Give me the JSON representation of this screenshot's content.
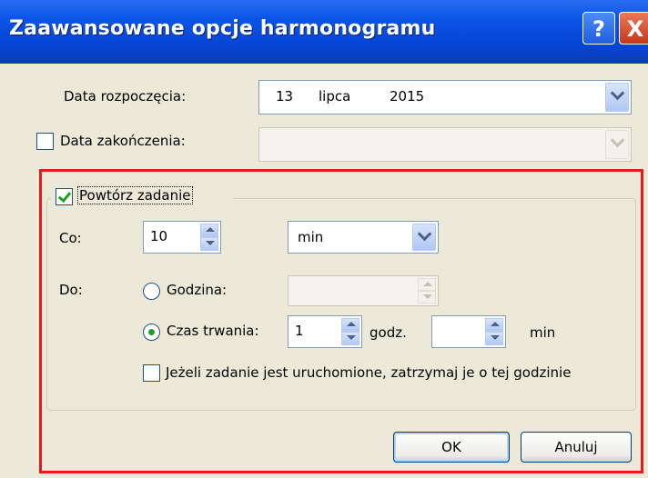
{
  "window": {
    "title": "Zaawansowane opcje harmonogramu",
    "help_label": "?",
    "close_label": "X"
  },
  "start_date": {
    "label": "Data rozpoczęcia:",
    "day": "13",
    "month": "lipca",
    "year": "2015"
  },
  "end_date": {
    "label": "Data zakończenia:",
    "checked": false,
    "value": ""
  },
  "repeat": {
    "label": "Powtórz zadanie",
    "checked": true,
    "every_label": "Co:",
    "every_value": "10",
    "every_unit": "min",
    "until_label": "Do:",
    "time_option_label": "Godzina:",
    "time_value": "",
    "duration_option_label": "Czas trwania:",
    "duration_selected": true,
    "duration_hours": "1",
    "hours_unit": "godz.",
    "duration_minutes": "",
    "minutes_unit": "min",
    "stop_label": "Jeżeli zadanie jest uruchomione, zatrzymaj je o tej godzinie",
    "stop_checked": false
  },
  "buttons": {
    "ok": "OK",
    "cancel": "Anuluj"
  },
  "colors": {
    "highlight": "#e31b1b",
    "titlebar": "#0a54e6",
    "dialog_bg": "#ece9d8"
  }
}
